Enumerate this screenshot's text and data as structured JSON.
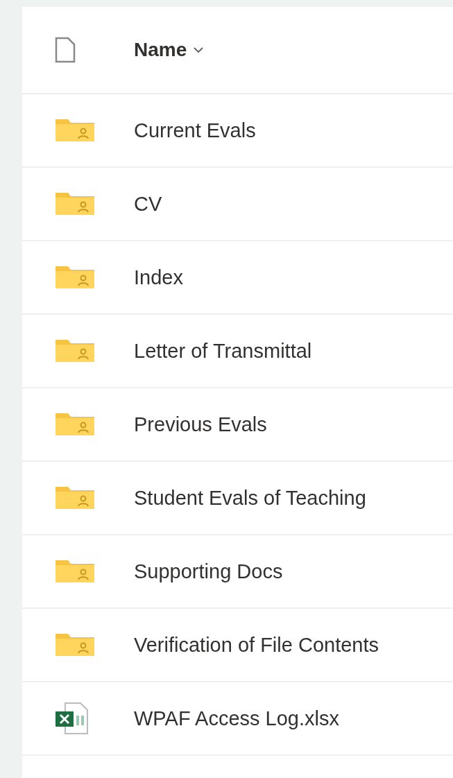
{
  "header": {
    "label": "Name"
  },
  "rows": [
    {
      "name": "Current Evals",
      "kind": "shared-folder"
    },
    {
      "name": "CV",
      "kind": "shared-folder"
    },
    {
      "name": "Index",
      "kind": "shared-folder"
    },
    {
      "name": "Letter of Transmittal",
      "kind": "shared-folder"
    },
    {
      "name": "Previous Evals",
      "kind": "shared-folder"
    },
    {
      "name": "Student Evals of Teaching",
      "kind": "shared-folder"
    },
    {
      "name": "Supporting Docs",
      "kind": "shared-folder"
    },
    {
      "name": "Verification of File Contents",
      "kind": "shared-folder"
    },
    {
      "name": "WPAF Access Log.xlsx",
      "kind": "spreadsheet"
    }
  ]
}
